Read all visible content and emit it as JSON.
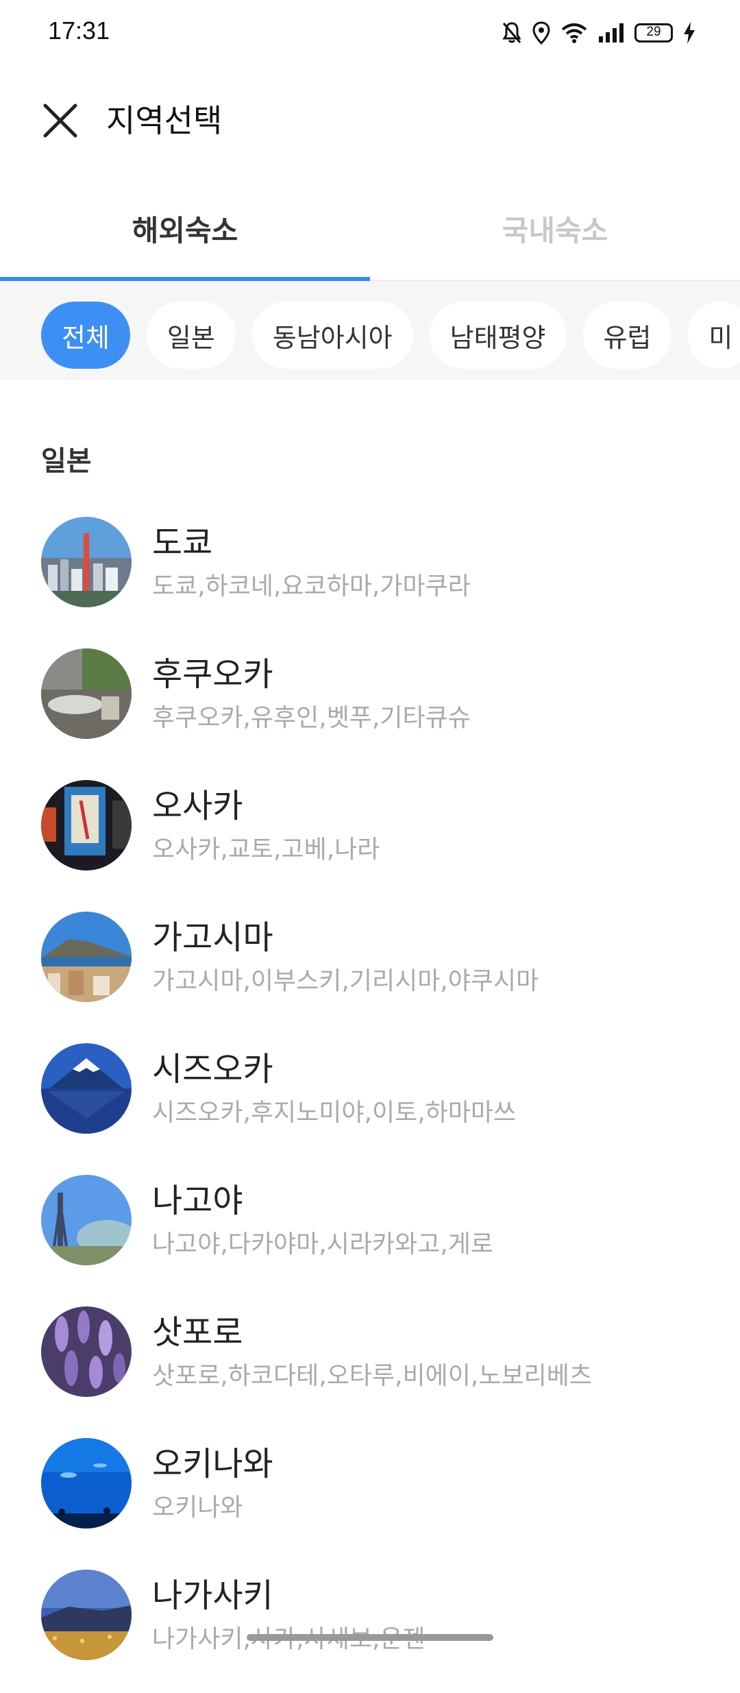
{
  "status_bar": {
    "time": "17:31",
    "battery": "29"
  },
  "header": {
    "title": "지역선택"
  },
  "tabs": [
    {
      "label": "해외숙소",
      "active": true
    },
    {
      "label": "국내숙소",
      "active": false
    }
  ],
  "chips": [
    {
      "label": "전체",
      "active": true
    },
    {
      "label": "일본"
    },
    {
      "label": "동남아시아"
    },
    {
      "label": "남태평양"
    },
    {
      "label": "유럽"
    },
    {
      "label": "미"
    }
  ],
  "section": {
    "title": "일본"
  },
  "regions": [
    {
      "name": "도쿄",
      "sub": "도쿄,하코네,요코하마,가마쿠라"
    },
    {
      "name": "후쿠오카",
      "sub": "후쿠오카,유후인,벳푸,기타큐슈"
    },
    {
      "name": "오사카",
      "sub": "오사카,교토,고베,나라"
    },
    {
      "name": "가고시마",
      "sub": "가고시마,이부스키,기리시마,야쿠시마"
    },
    {
      "name": "시즈오카",
      "sub": "시즈오카,후지노미야,이토,하마마쓰"
    },
    {
      "name": "나고야",
      "sub": "나고야,다카야마,시라카와고,게로"
    },
    {
      "name": "삿포로",
      "sub": "삿포로,하코다테,오타루,비에이,노보리베츠"
    },
    {
      "name": "오키나와",
      "sub": "오키나와"
    },
    {
      "name": "나가사키",
      "sub": "나가사키,사가,사세보,운젠"
    }
  ],
  "colors": {
    "accent": "#3d8ff3",
    "tab_indicator": "#3b87f0",
    "muted_text": "#aaaaaa"
  }
}
